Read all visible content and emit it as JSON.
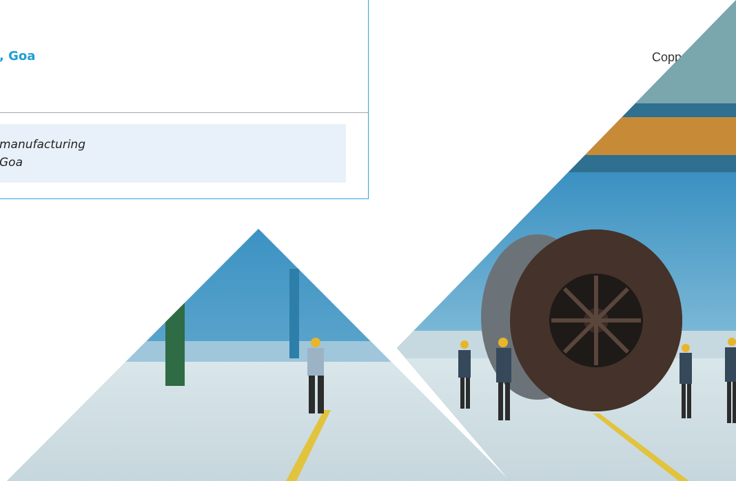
{
  "info_card": {
    "location": ", Goa",
    "product": "Copper rods",
    "caption_line1": "manufacturing",
    "caption_line2": "Goa"
  },
  "colors": {
    "accent_blue": "#2aa7dc",
    "caption_bg": "#e8f1fa"
  },
  "photos": [
    {
      "name": "factory-floor-worker"
    },
    {
      "name": "cable-drum-factory"
    }
  ]
}
